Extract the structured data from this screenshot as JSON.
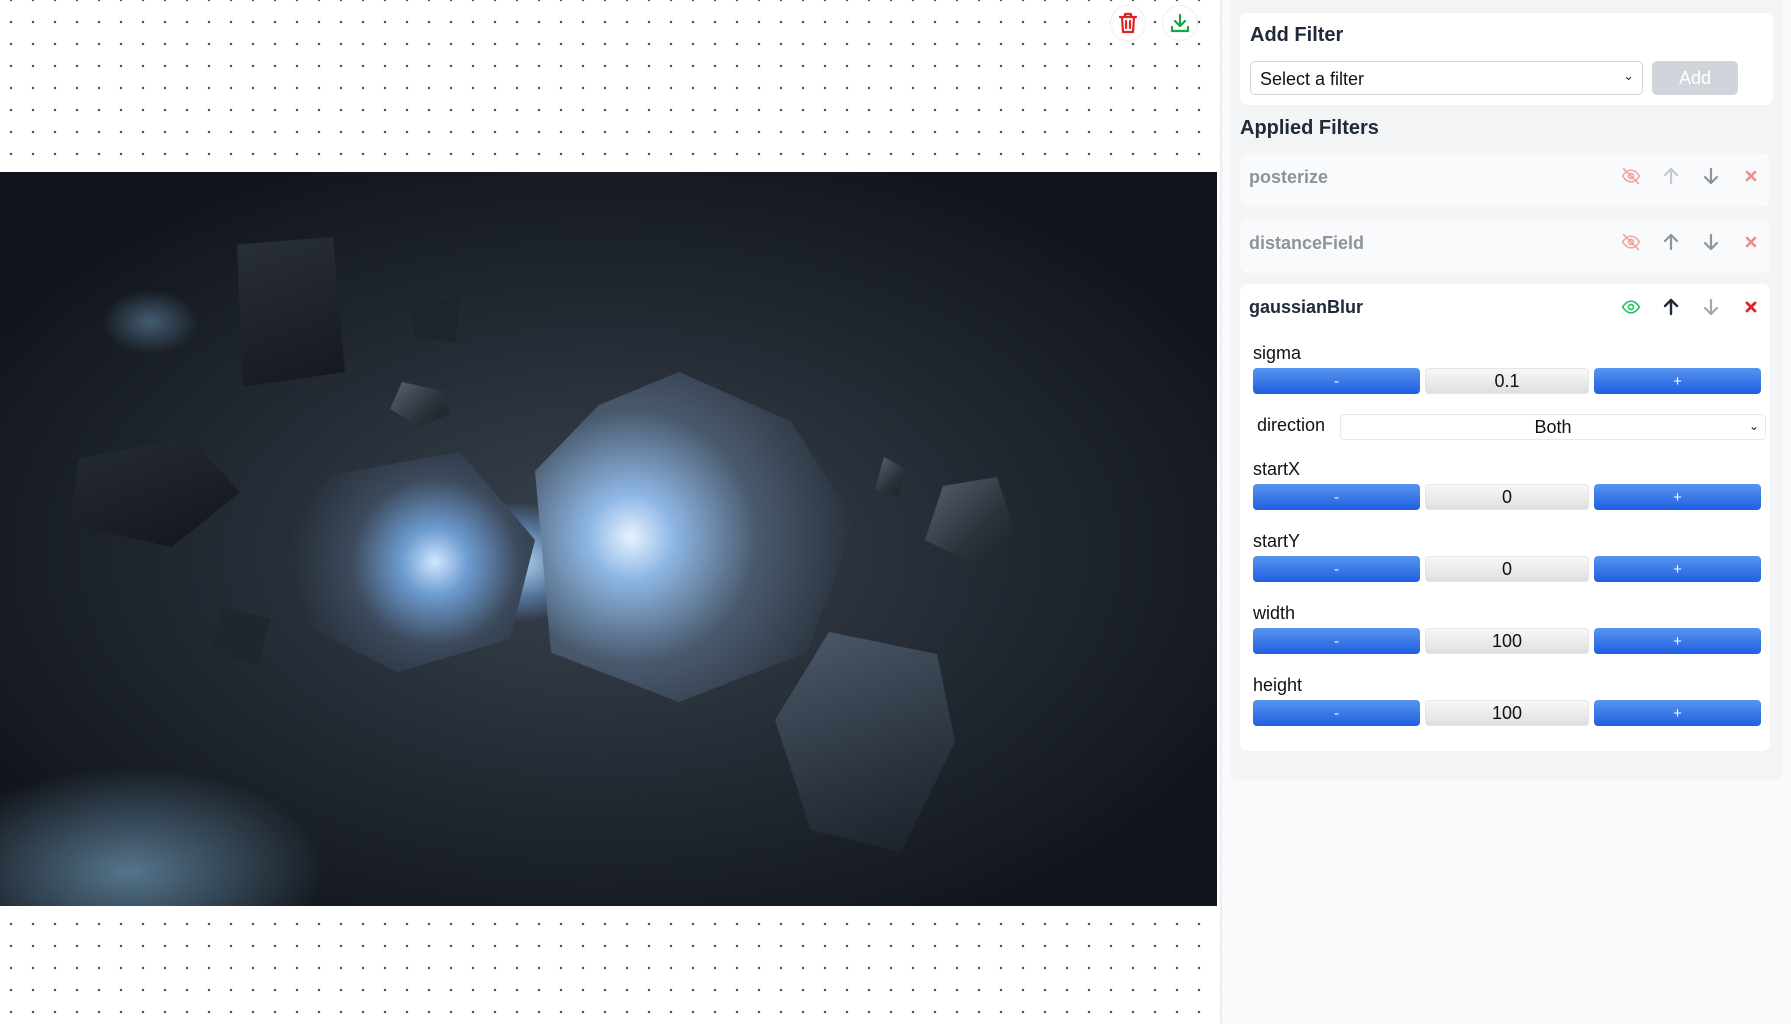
{
  "canvas": {
    "delete_icon": "trash-icon",
    "download_icon": "download-icon"
  },
  "add_filter": {
    "title": "Add Filter",
    "select_value": "Select a filter",
    "add_label": "Add"
  },
  "applied": {
    "title": "Applied Filters",
    "filters": [
      {
        "name": "posterize",
        "visible": false,
        "state": "inactive"
      },
      {
        "name": "distanceField",
        "visible": false,
        "state": "inactive"
      },
      {
        "name": "gaussianBlur",
        "visible": true,
        "state": "active",
        "params": {
          "sigma": {
            "label": "sigma",
            "value": "0.1",
            "minus": "-",
            "plus": "+"
          },
          "direction": {
            "label": "direction",
            "value": "Both"
          },
          "startX": {
            "label": "startX",
            "value": "0",
            "minus": "-",
            "plus": "+"
          },
          "startY": {
            "label": "startY",
            "value": "0",
            "minus": "-",
            "plus": "+"
          },
          "width": {
            "label": "width",
            "value": "100",
            "minus": "-",
            "plus": "+"
          },
          "height": {
            "label": "height",
            "value": "100",
            "minus": "-",
            "plus": "+"
          }
        }
      }
    ]
  },
  "colors": {
    "accent_blue": "#2563eb",
    "delete_red": "#dc2626",
    "download_green": "#16a34a",
    "visible_green": "#22c55e"
  }
}
